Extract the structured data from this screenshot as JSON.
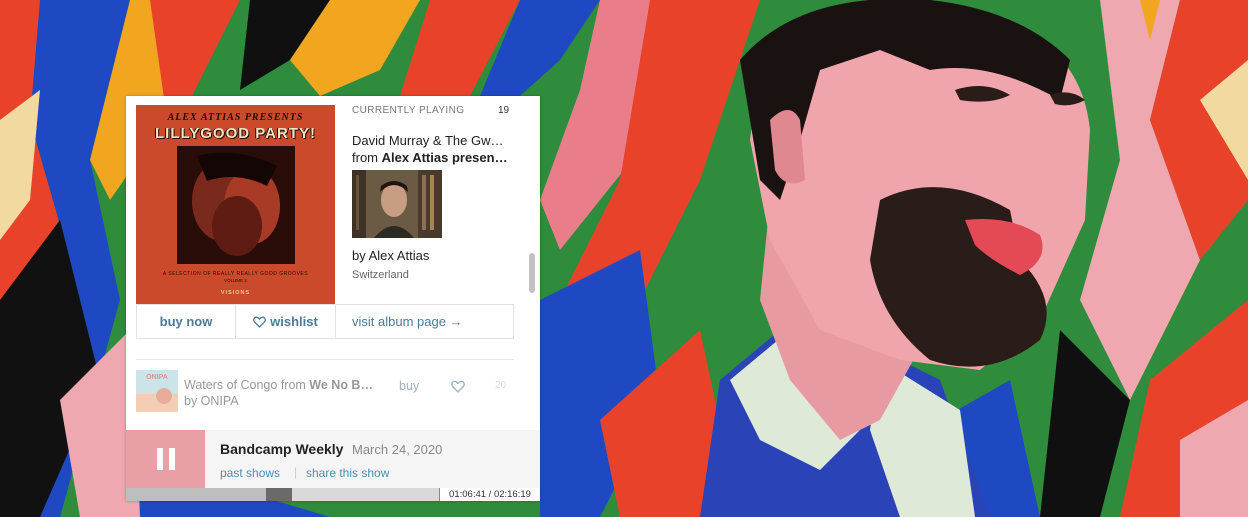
{
  "album": {
    "cover_line1": "ALEX ATTIAS PRESENTS",
    "cover_line2": "LILLYGOOD PARTY!",
    "cover_sub": "A SELECTION OF REALLY REALLY GOOD GROOVES",
    "cover_volume": "VOLUME 2",
    "cover_label": "VISIONS"
  },
  "current": {
    "label": "CURRENTLY PLAYING",
    "number": "19",
    "track": "David Murray & The Gw…",
    "from_prefix": "from ",
    "album": "Alex Attias presen…",
    "by": "by Alex Attias",
    "location": "Switzerland"
  },
  "actions": {
    "buy_now": "buy now",
    "wishlist": "wishlist",
    "visit": "visit album page →"
  },
  "next": {
    "thumb_text": "ONIPA",
    "title": "Waters of Congo",
    "from_word": " from ",
    "album": "We No B…",
    "by": "by ONIPA",
    "buy": "buy",
    "number": "20"
  },
  "show": {
    "title": "Bandcamp Weekly",
    "date": "March 24, 2020",
    "past_shows": "past shows",
    "separator": "|",
    "share": "share this show",
    "time": "01:06:41 / 02:16:19",
    "progress": 0.49
  },
  "colors": {
    "link": "#4d7a94",
    "pause_button": "#e8a0a6",
    "cover_bg": "#cc4a2c"
  }
}
